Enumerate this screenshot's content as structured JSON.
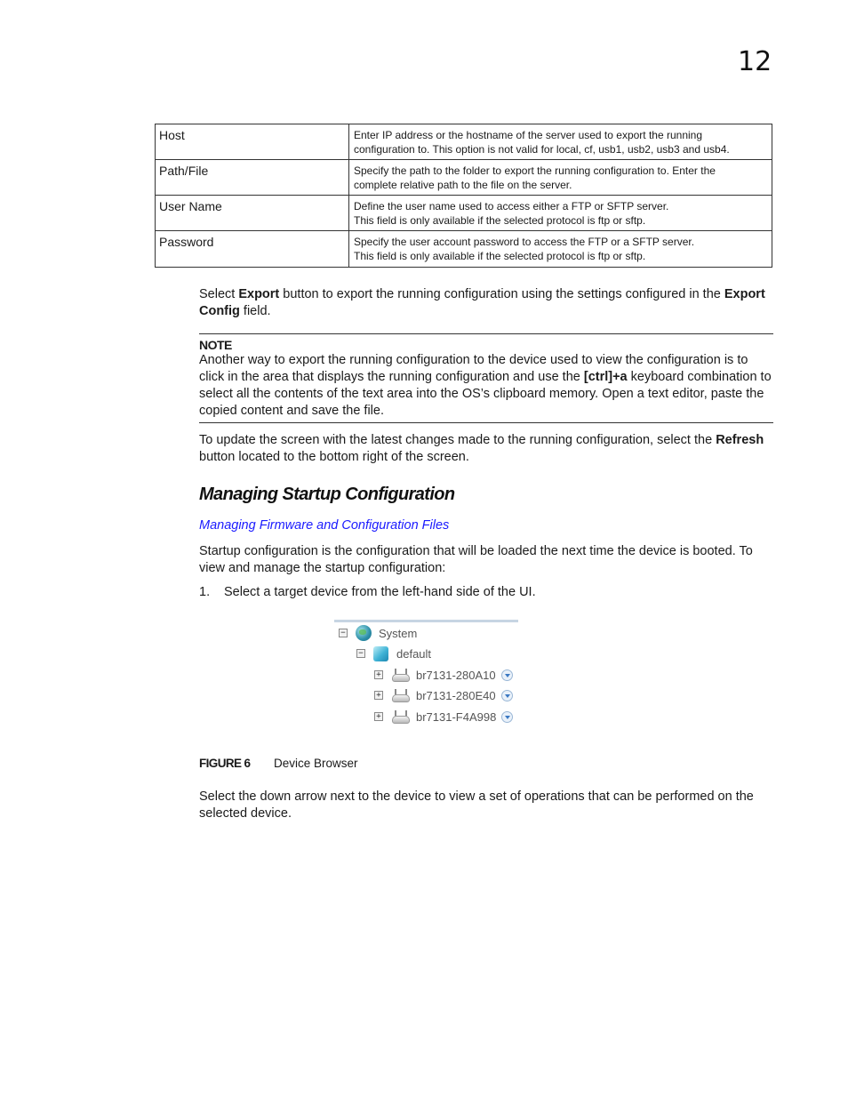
{
  "page": {
    "chapter_number": "12"
  },
  "param_table": {
    "rows": [
      {
        "name": "Host",
        "desc_lines": [
          "Enter IP address or the hostname of the server used to export the running",
          "configuration to. This option is not valid for local, cf, usb1, usb2, usb3 and usb4."
        ]
      },
      {
        "name": "Path/File",
        "desc_lines": [
          "Specify the path to the folder to export the running configuration to. Enter the",
          "complete relative path to the file on the server."
        ]
      },
      {
        "name": "User Name",
        "desc_lines": [
          "Define the user name used to access either a FTP or SFTP server.",
          "This field is only available if the selected protocol is ftp or sftp."
        ]
      },
      {
        "name": "Password",
        "desc_lines": [
          "Specify the user account password to access the FTP or a SFTP server.",
          "This field is only available if the selected protocol is ftp or sftp."
        ]
      }
    ]
  },
  "export_para": {
    "t1": "Select ",
    "b1": "Export",
    "t2": " button to export the running configuration using the settings configured in the ",
    "b2": "Export Config",
    "t3": " field."
  },
  "note": {
    "label": "NOTE",
    "t1": "Another way to export the running configuration to the device used to view the configuration is to click in the area that displays the running configuration and use the ",
    "b1": "[ctrl]+a",
    "t2": " keyboard combination to select all the contents of the text area into the OS’s clipboard memory. Open a text editor, paste the copied content and save the file."
  },
  "refresh_para": {
    "t1": "To update the screen with the latest changes made to the running configuration, select the ",
    "b1": "Refresh",
    "t2": " button located to the bottom right of the screen."
  },
  "section": {
    "title": "Managing Startup Configuration",
    "xref": "Managing Firmware and Configuration Files",
    "intro": "Startup configuration is the configuration that will be loaded the next time the device is booted. To view and manage the startup configuration:"
  },
  "steps": [
    {
      "num": "1.",
      "text": "Select a target device from the left-hand side of the UI."
    }
  ],
  "device_tree": {
    "root": {
      "label": "System",
      "expander": "−"
    },
    "group": {
      "label": "default",
      "expander": "−"
    },
    "devices": [
      {
        "label": "br7131-280A10",
        "expander": "+"
      },
      {
        "label": "br7131-280E40",
        "expander": "+"
      },
      {
        "label": "br7131-F4A998",
        "expander": "+"
      }
    ]
  },
  "figure": {
    "number": "FIGURE 6",
    "title": "Device Browser"
  },
  "after_figure": {
    "text": "Select the down arrow next to the device to view a set of operations that can be performed on the selected device."
  }
}
